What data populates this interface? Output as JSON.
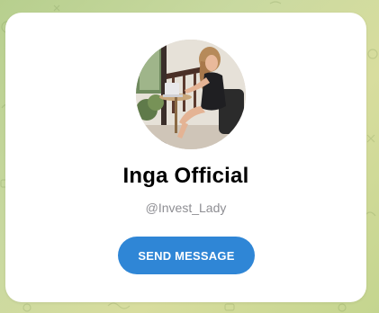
{
  "profile": {
    "name": "Inga Official",
    "username": "@Invest_Lady",
    "avatar_icon": "profile-photo"
  },
  "actions": {
    "send_message_label": "SEND MESSAGE"
  },
  "colors": {
    "accent": "#2f86d6",
    "card": "#ffffff",
    "muted_text": "#8e8e93"
  }
}
